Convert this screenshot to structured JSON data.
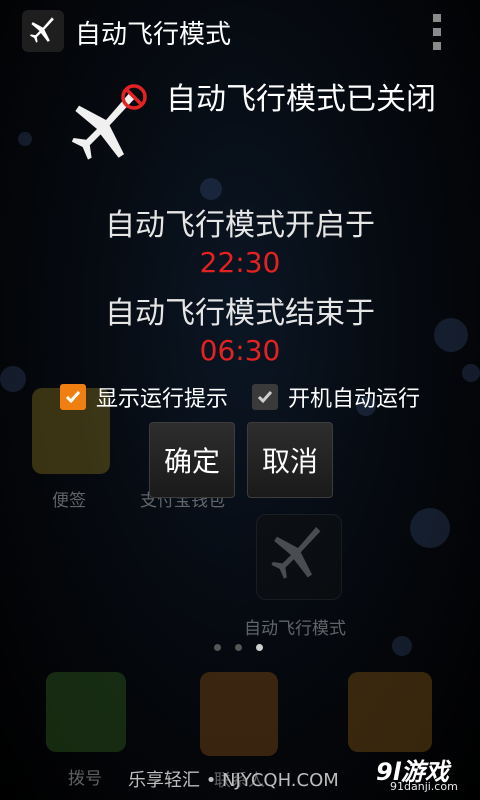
{
  "app": {
    "title": "自动飞行模式",
    "menu_icon": "overflow-menu-icon"
  },
  "status": {
    "text": "自动飞行模式已关闭",
    "icon": "airplane-icon",
    "badge_icon": "prohibited-icon"
  },
  "schedule": {
    "start_label": "自动飞行模式开启于",
    "start_time": "22:30",
    "end_label": "自动飞行模式结束于",
    "end_time": "06:30",
    "time_color": "#e52222"
  },
  "options": {
    "show_tips_label": "显示运行提示",
    "show_tips_checked": true,
    "autostart_label": "开机自动运行",
    "autostart_checked": true
  },
  "buttons": {
    "confirm": "确定",
    "cancel": "取消"
  },
  "background": {
    "tile1_label": "便签",
    "tile2_label": "支付宝钱包",
    "tile3_label": "自动飞行模式",
    "dock1_label": "拨号",
    "dock2_label": "联系人"
  },
  "footer": {
    "brand": "乐享轻汇 • NJYCQH.COM",
    "watermark_main": "9l游戏",
    "watermark_sub": "91danji.com"
  },
  "colors": {
    "accent_orange": "#f07f12",
    "background": "#000000"
  }
}
